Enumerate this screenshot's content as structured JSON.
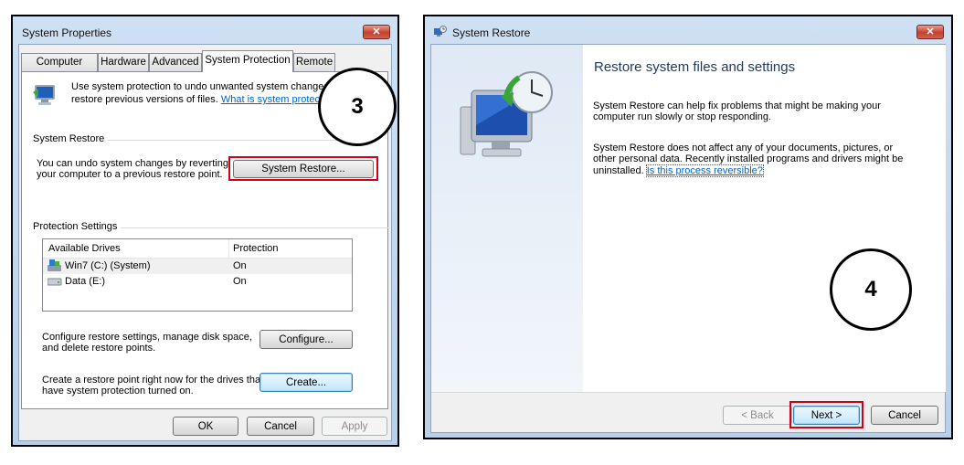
{
  "left_window": {
    "title": "System Properties",
    "close_label": "✕",
    "tabs": [
      "Computer Name",
      "Hardware",
      "Advanced",
      "System Protection",
      "Remote"
    ],
    "intro_line1": "Use system protection to undo unwanted system changes",
    "intro_line2_prefix": "restore previous versions of files.",
    "intro_link": "What is system protectio",
    "restore_group_title": "System Restore",
    "restore_text_line1": "You can undo system changes by reverting",
    "restore_text_line2": "your computer to a previous restore point.",
    "restore_button": "System Restore...",
    "protection_group_title": "Protection Settings",
    "table": {
      "headers": [
        "Available Drives",
        "Protection"
      ],
      "rows": [
        {
          "drive": "Win7 (C:) (System)",
          "protection": "On",
          "icon": "system-drive-icon"
        },
        {
          "drive": "Data (E:)",
          "protection": "On",
          "icon": "drive-icon"
        }
      ]
    },
    "configure_text_line1": "Configure restore settings, manage disk space,",
    "configure_text_line2": "and delete restore points.",
    "configure_button": "Configure...",
    "create_text_line1": "Create a restore point right now for the drives that",
    "create_text_line2": "have system protection turned on.",
    "create_button": "Create...",
    "ok_button": "OK",
    "cancel_button": "Cancel",
    "apply_button": "Apply",
    "step_marker": "3"
  },
  "right_window": {
    "title": "System Restore",
    "close_label": "✕",
    "heading": "Restore system files and settings",
    "para1_line1": "System Restore can help fix problems that might be making your",
    "para1_line2": "computer run slowly or stop responding.",
    "para2_line1": "System Restore does not affect any of your documents, pictures, or",
    "para2_line2": "other personal data. Recently installed programs and drivers might be",
    "para2_line3_prefix": "uninstalled.",
    "para2_link": "Is this process reversible?",
    "back_button": "< Back",
    "next_button": "Next >",
    "cancel_button": "Cancel",
    "step_marker": "4"
  },
  "colors": {
    "highlight_box": "#d0021b",
    "link": "#0066cc",
    "frame": "#b9d0ea"
  }
}
